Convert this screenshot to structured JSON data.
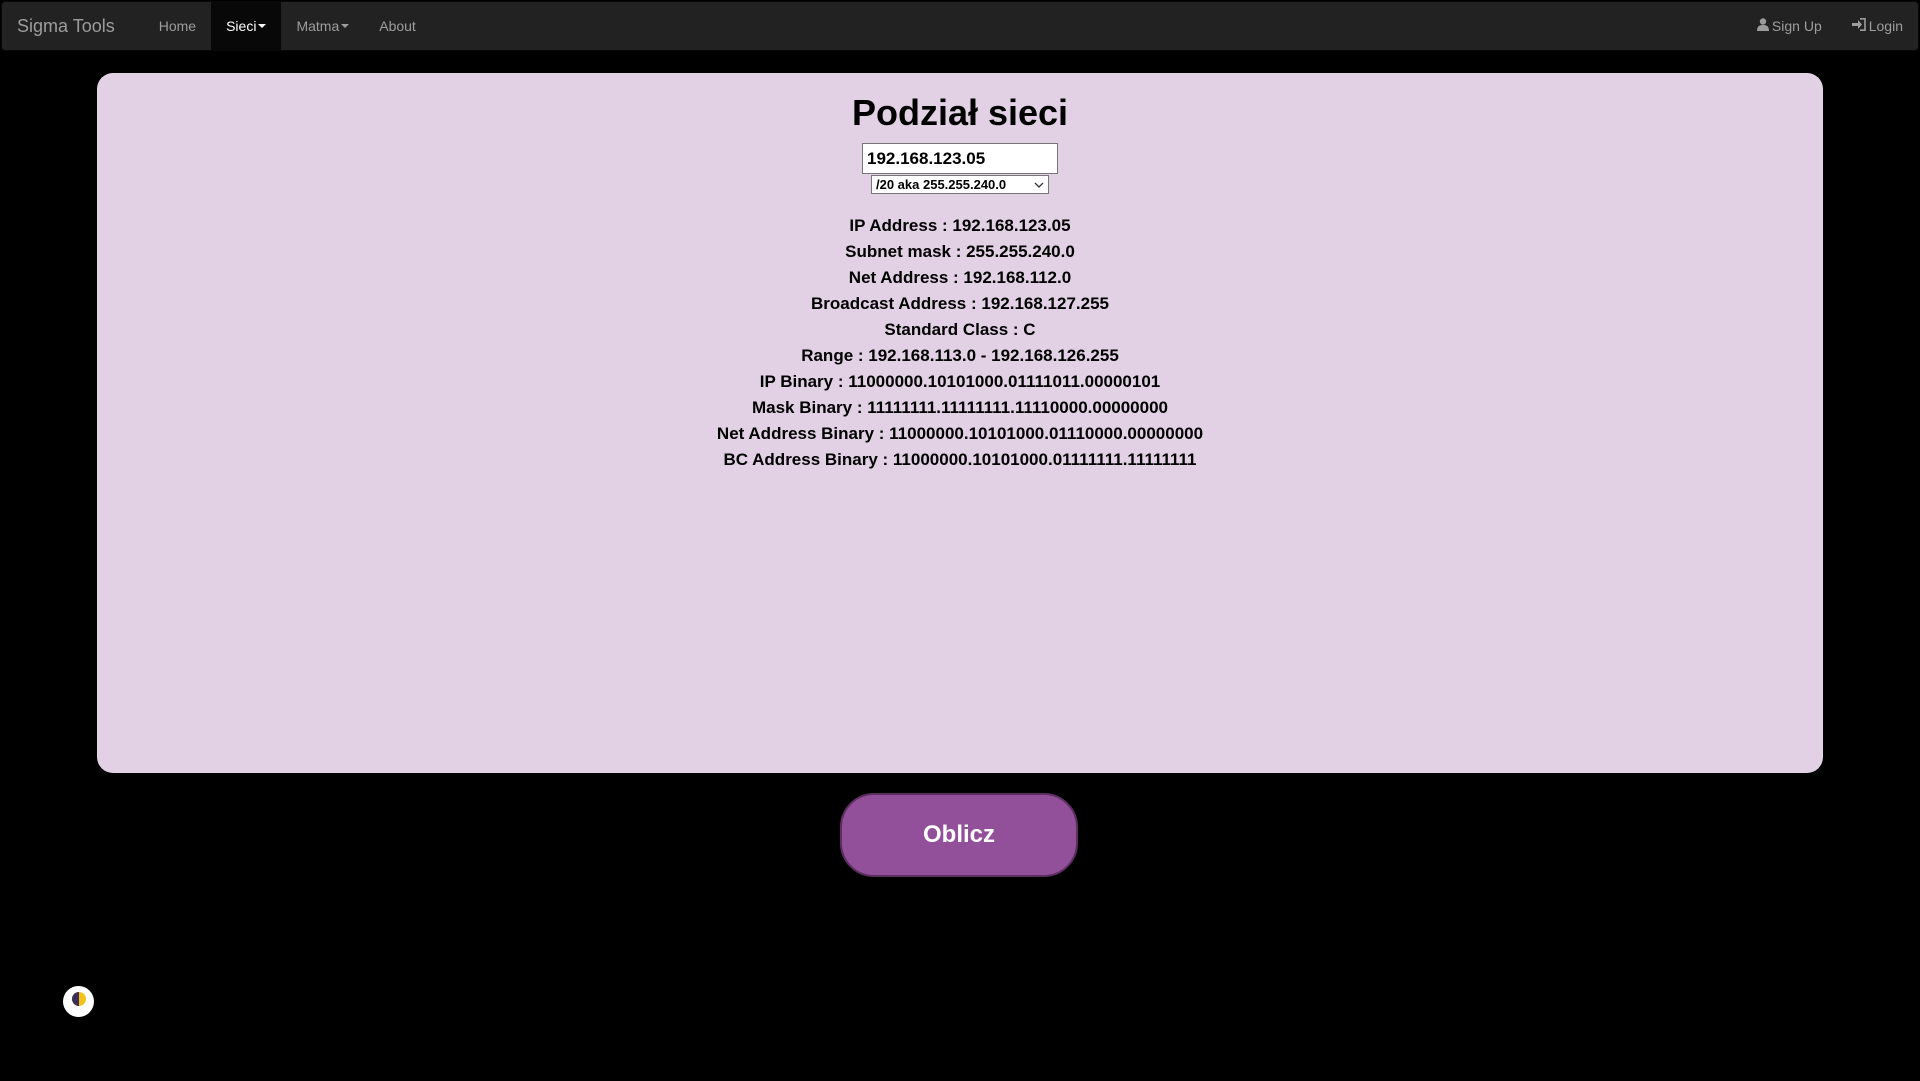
{
  "navbar": {
    "brand": "Sigma Tools",
    "items": [
      {
        "label": "Home"
      },
      {
        "label": "Sieci"
      },
      {
        "label": "Matma"
      },
      {
        "label": "About"
      }
    ],
    "right": [
      {
        "label": "Sign Up",
        "icon": "user-icon"
      },
      {
        "label": "Login",
        "icon": "login-icon"
      }
    ]
  },
  "main": {
    "title": "Podział sieci",
    "ip_input_value": "192.168.123.05",
    "mask_select_value": "/20 aka 255.255.240.0",
    "results": [
      "IP Address : 192.168.123.05",
      "Subnet mask : 255.255.240.0",
      "Net Address : 192.168.112.0",
      "Broadcast Address : 192.168.127.255",
      "Standard Class : C",
      "Range : 192.168.113.0 - 192.168.126.255",
      "IP Binary : 11000000.10101000.01111011.00000101",
      "Mask Binary : 11111111.11111111.11110000.00000000",
      "Net Address Binary : 11000000.10101000.01110000.00000000",
      "BC Address Binary : 11000000.10101000.01111111.11111111"
    ],
    "calc_button": "Oblicz"
  },
  "colors": {
    "panel": "#e2d1e5",
    "button": "#924f9a",
    "navbar": "#222222"
  },
  "icons": {
    "theme_toggle": "contrast-icon"
  }
}
